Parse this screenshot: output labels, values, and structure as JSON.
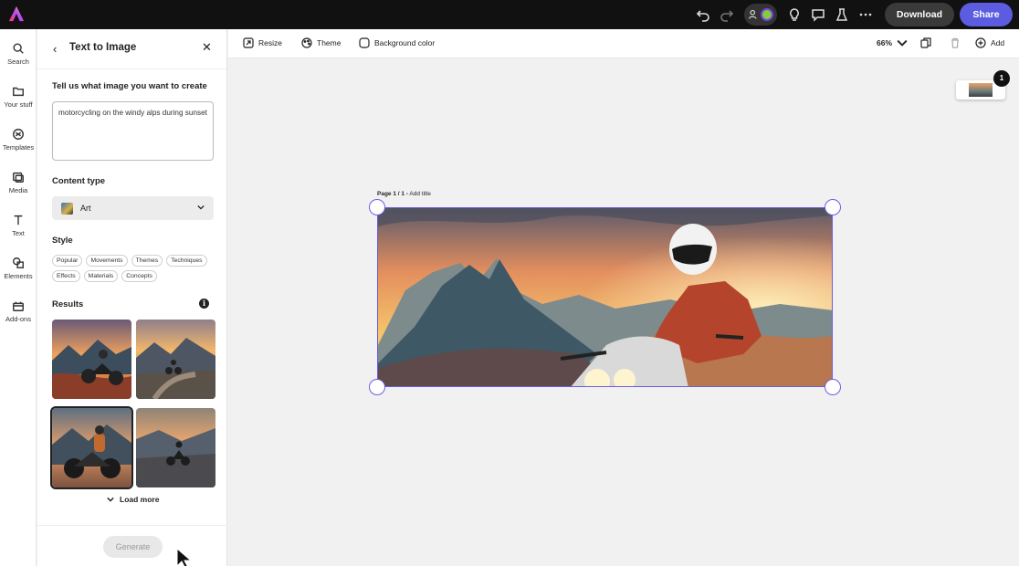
{
  "topbar": {
    "download_label": "Download",
    "share_label": "Share"
  },
  "rail": {
    "items": [
      {
        "label": "Search",
        "icon": "search-icon"
      },
      {
        "label": "Your stuff",
        "icon": "folder-icon"
      },
      {
        "label": "Templates",
        "icon": "templates-icon"
      },
      {
        "label": "Media",
        "icon": "media-icon"
      },
      {
        "label": "Text",
        "icon": "text-icon"
      },
      {
        "label": "Elements",
        "icon": "elements-icon"
      },
      {
        "label": "Add-ons",
        "icon": "addons-icon"
      }
    ]
  },
  "panel": {
    "title": "Text to Image",
    "prompt_label": "Tell us what image you want to create",
    "prompt_value": "motorcycling on the windy alps during sunset",
    "content_type_label": "Content type",
    "content_type_value": "Art",
    "style_label": "Style",
    "style_chips": [
      "Popular",
      "Movements",
      "Themes",
      "Techniques",
      "Effects",
      "Materials",
      "Concepts"
    ],
    "results_label": "Results",
    "load_more_label": "Load more",
    "generate_label": "Generate"
  },
  "toolbar": {
    "resize_label": "Resize",
    "theme_label": "Theme",
    "background_label": "Background color",
    "zoom_value": "66%",
    "add_label": "Add"
  },
  "canvas": {
    "page_label_bold": "Page 1 / 1 -",
    "page_label_rest": "Add title",
    "page_count_badge": "1"
  },
  "colors": {
    "accent": "#5c5ce0",
    "selection": "#6b5fe0",
    "topbar_bg": "#111111"
  }
}
